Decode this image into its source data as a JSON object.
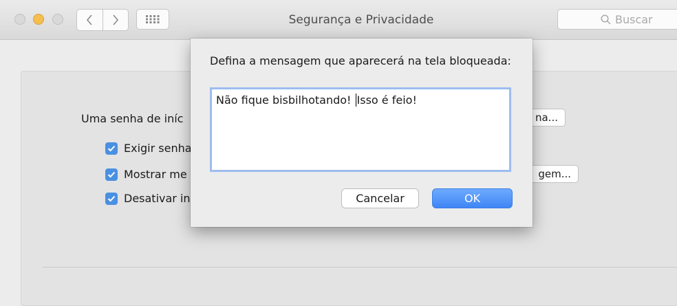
{
  "window": {
    "title": "Segurança e Privacidade"
  },
  "toolbar": {
    "search_placeholder": "Buscar"
  },
  "background": {
    "login_password_label": "Uma senha de iníc",
    "change_password_button": "na...",
    "checkboxes": [
      {
        "label": "Exigir senha",
        "checked": true
      },
      {
        "label": "Mostrar me",
        "checked": true
      },
      {
        "label": "Desativar in",
        "checked": true
      }
    ],
    "set_message_button": "gem..."
  },
  "dialog": {
    "prompt": "Defina a mensagem que aparecerá na tela bloqueada:",
    "message_before_caret": "Não fique bisbilhotando! ",
    "message_after_caret": "Isso é feio!",
    "cancel_label": "Cancelar",
    "ok_label": "OK"
  },
  "colors": {
    "accent": "#4a90e2",
    "ok_button": "#3f86f5",
    "focus_ring": "#9dbcf0"
  }
}
